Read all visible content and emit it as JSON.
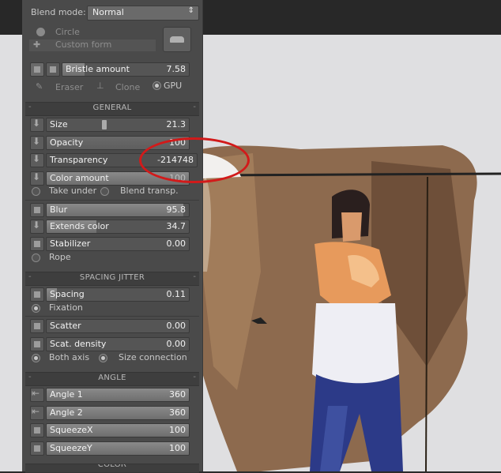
{
  "blend_mode": {
    "label": "Blend mode:",
    "value": "Normal"
  },
  "shapes": {
    "circle": "Circle",
    "custom_form": "Custom form"
  },
  "bristle": {
    "label": "Bristle amount",
    "value": "7.58"
  },
  "tools": {
    "eraser": "Eraser",
    "clone": "Clone",
    "gpu": "GPU"
  },
  "sections": {
    "general": "GENERAL",
    "spacing_jitter": "SPACING JITTER",
    "angle": "ANGLE",
    "color": "COLOR"
  },
  "general": {
    "size": {
      "label": "Size",
      "value": "21.3"
    },
    "opacity": {
      "label": "Opacity",
      "value": "100"
    },
    "transparency": {
      "label": "Transparency",
      "value": "-214748"
    },
    "color_amount": {
      "label": "Color amount",
      "value": "100"
    },
    "take_under": "Take under",
    "blend_transp": "Blend transp.",
    "blur": {
      "label": "Blur",
      "value": "95.8"
    },
    "extends_color": {
      "label": "Extends color",
      "value": "34.7"
    },
    "stabilizer": {
      "label": "Stabilizer",
      "value": "0.00"
    },
    "rope": "Rope"
  },
  "spacing_jitter": {
    "spacing": {
      "label": "Spacing",
      "value": "0.11"
    },
    "fixation": "Fixation",
    "scatter": {
      "label": "Scatter",
      "value": "0.00"
    },
    "scat_density": {
      "label": "Scat. density",
      "value": "0.00"
    },
    "both_axis": "Both axis",
    "size_connection": "Size connection"
  },
  "angle": {
    "angle1": {
      "label": "Angle 1",
      "value": "360"
    },
    "angle2": {
      "label": "Angle 2",
      "value": "360"
    },
    "squeezex": {
      "label": "SqueezeX",
      "value": "100"
    },
    "squeezey": {
      "label": "SqueezeY",
      "value": "100"
    }
  },
  "icons": [
    "brush-icon",
    "eraser-icon",
    "clone-stamp-icon",
    "arrow-down-icon",
    "arrow-left-icon",
    "square-icon",
    "stamp-icon"
  ],
  "colors": {
    "panel": "#4a4a4a",
    "slider_fill": "#7c7c7c",
    "highlight": "#d21a1a",
    "canvas": "#dfdfe1"
  }
}
